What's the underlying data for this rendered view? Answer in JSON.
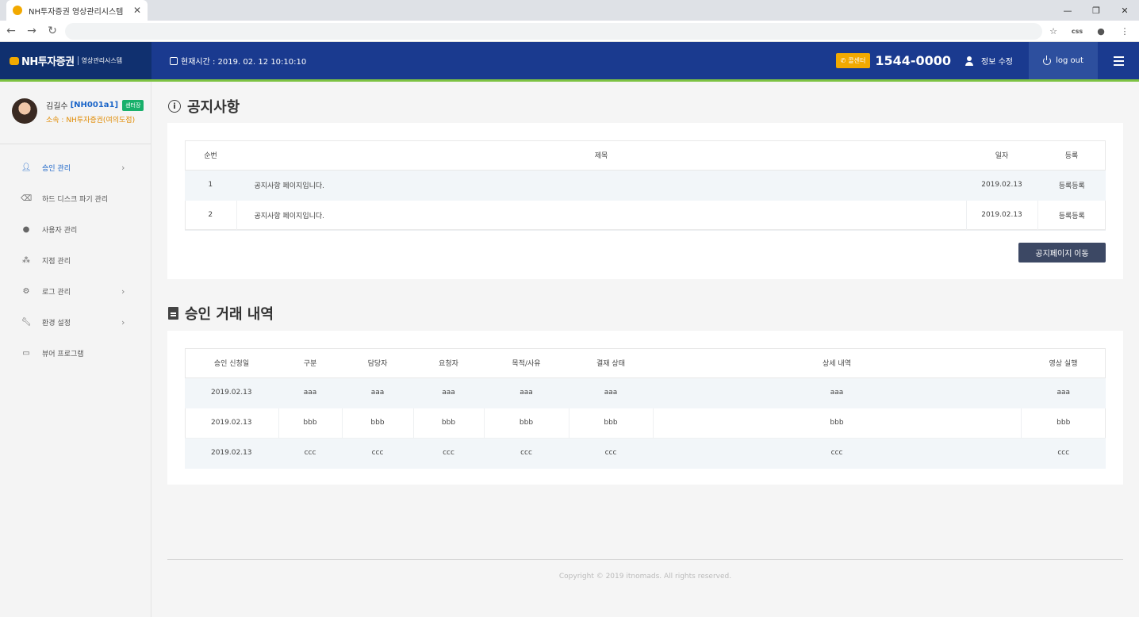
{
  "browser": {
    "tab_title": "NH투자증권 영상관리시스템",
    "tab_close": "✕",
    "ext_label": "css"
  },
  "header": {
    "logo_text": "NH투자증권",
    "logo_sub": "영상관리시스템",
    "clock_text": "현재시간 : 2019. 02. 12 10:10:10",
    "callcenter_badge": "콜센터",
    "phone": "1544-0000",
    "profile_edit": "정보 수정",
    "logout": "log out"
  },
  "user": {
    "name": "김길수",
    "id": "[NH001a1]",
    "role": "센터장",
    "org": "소속 : NH투자증권(여의도점)"
  },
  "sidebar": {
    "items": [
      {
        "label": "승인 관리",
        "icon": "user-check-icon",
        "has_children": true,
        "active": true
      },
      {
        "label": "하드 디스크 파기 관리",
        "icon": "broom-icon",
        "has_children": false
      },
      {
        "label": "사용자 관리",
        "icon": "user-icon",
        "has_children": false
      },
      {
        "label": "지점 관리",
        "icon": "sitemap-icon",
        "has_children": false
      },
      {
        "label": "로그 관리",
        "icon": "gear-icon",
        "has_children": true
      },
      {
        "label": "환경 설정",
        "icon": "wrench-icon",
        "has_children": true
      },
      {
        "label": "뷰어 프로그램",
        "icon": "monitor-icon",
        "has_children": false
      }
    ]
  },
  "notice": {
    "title": "공지사항",
    "columns": [
      "순번",
      "제목",
      "일자",
      "등록"
    ],
    "rows": [
      [
        "1",
        "공지사항 페이지입니다.",
        "2019.02.13",
        "등록등록"
      ],
      [
        "2",
        "공지사항 페이지입니다.",
        "2019.02.13",
        "등록등록"
      ]
    ],
    "button": "공지페이지 이동"
  },
  "approval": {
    "title": "승인 거래 내역",
    "columns": [
      "승인 신청일",
      "구분",
      "담당자",
      "요청자",
      "목적/사유",
      "결재 상태",
      "상세 내역",
      "영상 실행"
    ],
    "rows": [
      [
        "2019.02.13",
        "aaa",
        "aaa",
        "aaa",
        "aaa",
        "aaa",
        "aaa",
        "aaa"
      ],
      [
        "2019.02.13",
        "bbb",
        "bbb",
        "bbb",
        "bbb",
        "bbb",
        "bbb",
        "bbb"
      ],
      [
        "2019.02.13",
        "ccc",
        "ccc",
        "ccc",
        "ccc",
        "ccc",
        "ccc",
        "ccc"
      ]
    ]
  },
  "footer": {
    "copyright": "Copyright © 2019 itnomads. All rights reserved."
  },
  "colors": {
    "header_bg": "#1a3a8f",
    "accent_green": "#7dc242",
    "accent_orange": "#f2a900",
    "button_dark": "#3c4864"
  }
}
